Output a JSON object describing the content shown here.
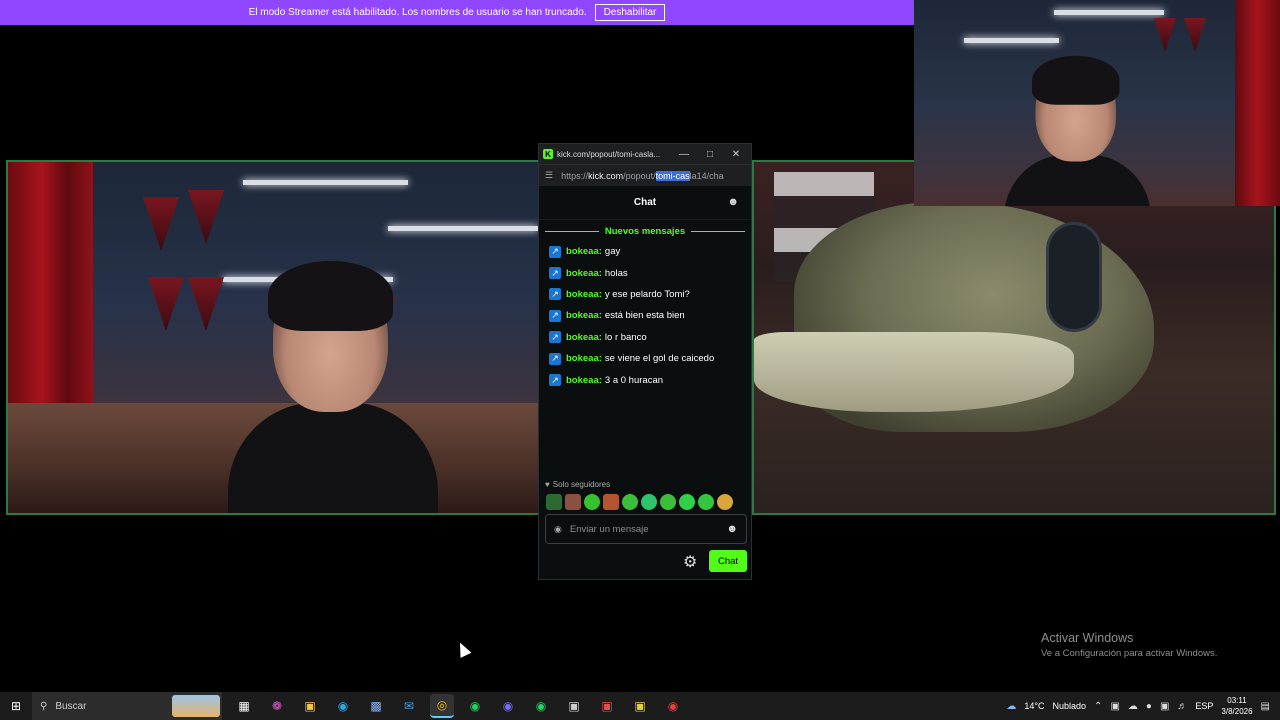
{
  "banner": {
    "text": "El modo Streamer está habilitado. Los nombres de usuario se han truncado.",
    "button": "Deshabilitar"
  },
  "popout": {
    "window_title": "kick.com/popout/tomi-casla...",
    "url_prefix": "https://",
    "url_host": "kick.com",
    "url_path": "/popout/",
    "url_selected": "tomi-cas",
    "url_rest": "la14/cha",
    "chat_title": "Chat",
    "new_messages": "Nuevos mensajes",
    "messages": [
      {
        "user": "bokeaa:",
        "text": "gay"
      },
      {
        "user": "bokeaa:",
        "text": "holas"
      },
      {
        "user": "bokeaa:",
        "text": "y ese pelardo Tomi?"
      },
      {
        "user": "bokeaa:",
        "text": "está bien esta bien"
      },
      {
        "user": "bokeaa:",
        "text": "lo r banco"
      },
      {
        "user": "bokeaa:",
        "text": "se viene el gol de caicedo"
      },
      {
        "user": "bokeaa:",
        "text": "3 a 0 huracan"
      }
    ],
    "followers_only": "Solo seguidores",
    "input_placeholder": "Enviar un mensaje",
    "chat_button": "Chat"
  },
  "activate_windows": {
    "title": "Activar Windows",
    "subtitle": "Ve a Configuración para activar Windows."
  },
  "taskbar": {
    "search": "Buscar",
    "weather": "14°C",
    "weather_desc": "Nublado",
    "lang": "ESP",
    "time": "03:11",
    "date": "3/8/2026"
  },
  "colors": {
    "accent": "#53fc18",
    "banner": "#9146ff",
    "badge": "#1976d2"
  }
}
